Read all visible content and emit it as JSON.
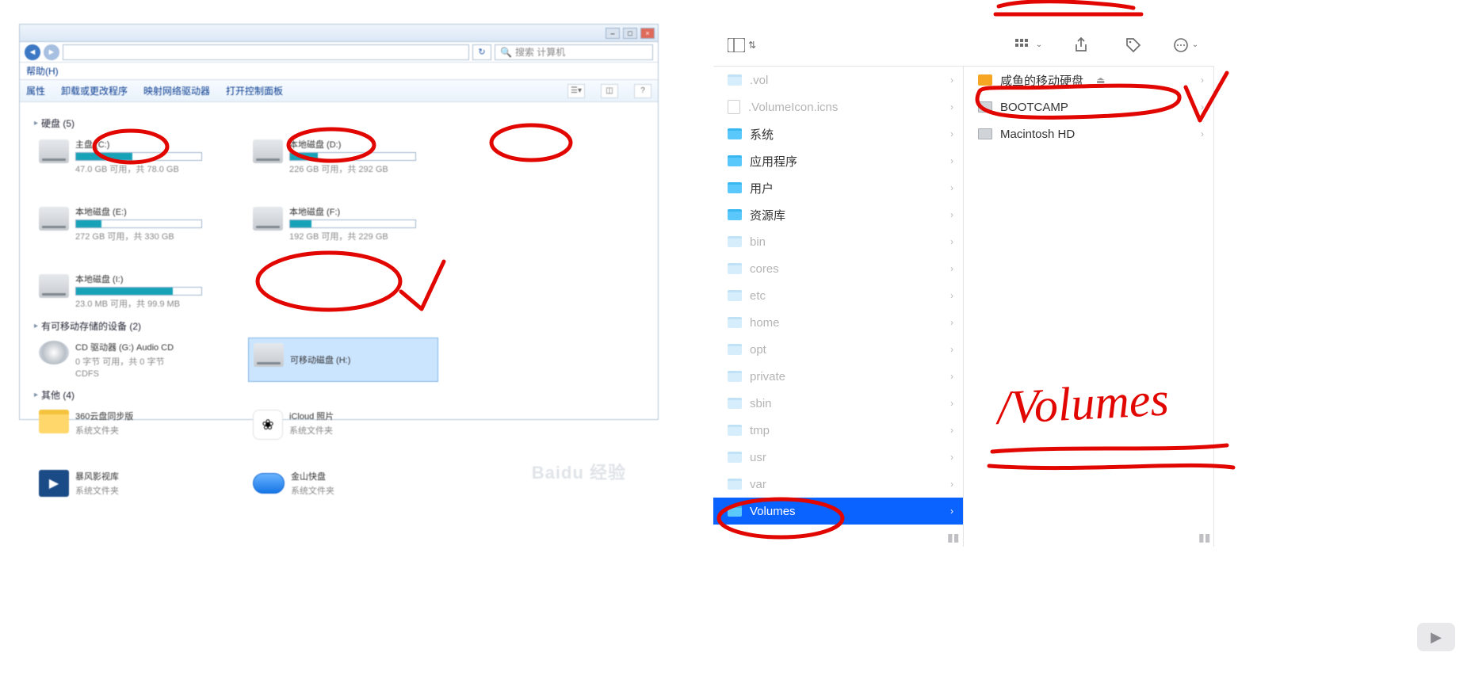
{
  "win": {
    "search_placeholder": "搜索 计算机",
    "menu": {
      "help": "帮助(H)",
      "i0": "属性",
      "i1": "卸载或更改程序",
      "i2": "映射网络驱动器",
      "i3": "打开控制面板"
    },
    "groups": {
      "disks": {
        "title": "硬盘 (5)"
      },
      "removable": {
        "title": "有可移动存储的设备 (2)"
      },
      "other": {
        "title": "其他 (4)"
      }
    },
    "drives": {
      "c": {
        "name": "主盘 (C:)",
        "sub": "47.0 GB 可用，共 78.0 GB",
        "fill": 45
      },
      "d": {
        "name": "本地磁盘 (D:)",
        "sub": "226 GB 可用，共 292 GB",
        "fill": 22
      },
      "e": {
        "name": "本地磁盘 (E:)",
        "sub": "272 GB 可用，共 330 GB",
        "fill": 20
      },
      "f": {
        "name": "本地磁盘 (F:)",
        "sub": "192 GB 可用，共 229 GB",
        "fill": 17
      },
      "i": {
        "name": "本地磁盘 (I:)",
        "sub": "23.0 MB 可用，共 99.9 MB",
        "fill": 77
      }
    },
    "removable": {
      "cd": {
        "name": "CD 驱动器 (G:) Audio CD",
        "sub": "0 字节 可用，共 0 字节",
        "fs": "CDFS"
      },
      "h": {
        "name": "可移动磁盘 (H:)"
      }
    },
    "other": {
      "o1": {
        "name": "360云盘同步版",
        "sub": "系统文件夹"
      },
      "o2": {
        "name": "iCloud 照片",
        "sub": "系统文件夹"
      },
      "o3": {
        "name": "暴风影视库",
        "sub": "系统文件夹"
      },
      "o4": {
        "name": "金山快盘",
        "sub": "系统文件夹"
      }
    },
    "watermark": "Baidu 经验"
  },
  "mac": {
    "col1": [
      {
        "name": ".vol",
        "type": "fld-dim"
      },
      {
        "name": ".VolumeIcon.icns",
        "type": "file-dim"
      },
      {
        "name": "系统",
        "type": "fld"
      },
      {
        "name": "应用程序",
        "type": "fld"
      },
      {
        "name": "用户",
        "type": "fld"
      },
      {
        "name": "资源库",
        "type": "fld"
      },
      {
        "name": "bin",
        "type": "fld-dim"
      },
      {
        "name": "cores",
        "type": "fld-dim"
      },
      {
        "name": "etc",
        "type": "fld-dim"
      },
      {
        "name": "home",
        "type": "fld-dim"
      },
      {
        "name": "opt",
        "type": "fld-dim"
      },
      {
        "name": "private",
        "type": "fld-dim"
      },
      {
        "name": "sbin",
        "type": "fld-dim"
      },
      {
        "name": "tmp",
        "type": "fld-dim"
      },
      {
        "name": "usr",
        "type": "fld-dim"
      },
      {
        "name": "var",
        "type": "fld-dim"
      },
      {
        "name": "Volumes",
        "type": "fld-sel"
      }
    ],
    "col2": [
      {
        "name": "咸鱼的移动硬盘",
        "type": "ext",
        "eject": true
      },
      {
        "name": "BOOTCAMP",
        "type": "hdd"
      },
      {
        "name": "Macintosh HD",
        "type": "hdd"
      }
    ]
  },
  "annotation_text": "/Volumes"
}
